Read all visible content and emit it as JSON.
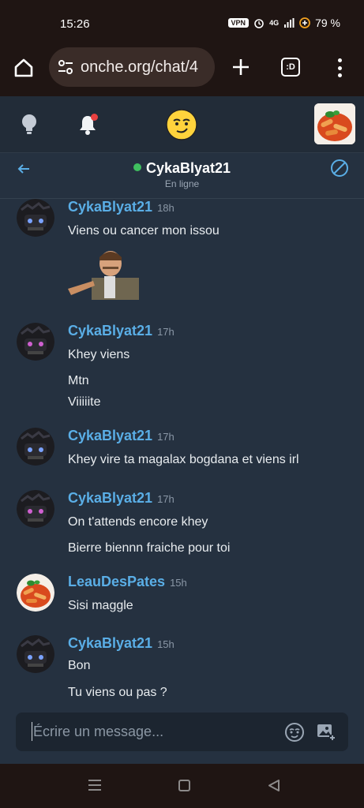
{
  "status_bar": {
    "time": "15:26",
    "vpn": "VPN",
    "network": "4G",
    "battery": "79 %"
  },
  "browser": {
    "url": "onche.org/chat/4",
    "tabs_label": ":D"
  },
  "chat": {
    "contact_name": "CykaBlyat21",
    "contact_status": "En ligne"
  },
  "messages": [
    {
      "user": "CykaBlyat21",
      "time": "18h",
      "lines": [
        "Viens ou cancer mon issou"
      ],
      "has_sticker": true
    },
    {
      "user": "CykaBlyat21",
      "time": "17h",
      "lines": [
        "Khey viens",
        "Mtn",
        "Viiiiite"
      ]
    },
    {
      "user": "CykaBlyat21",
      "time": "17h",
      "lines": [
        "Khey vire ta magalax bogdana et viens irl"
      ]
    },
    {
      "user": "CykaBlyat21",
      "time": "17h",
      "lines": [
        "On t'attends encore khey",
        "Bierre biennn fraiche pour toi"
      ]
    },
    {
      "user": "LeauDesPates",
      "time": "15h",
      "lines": [
        "Sisi maggle"
      ]
    },
    {
      "user": "CykaBlyat21",
      "time": "15h",
      "lines": [
        "Bon",
        "Tu viens ou pas ?"
      ]
    }
  ],
  "composer": {
    "placeholder": "Écrire un message..."
  },
  "colors": {
    "accent_username": "#5aaee6",
    "online": "#3fbf5f",
    "background": "#253140"
  }
}
